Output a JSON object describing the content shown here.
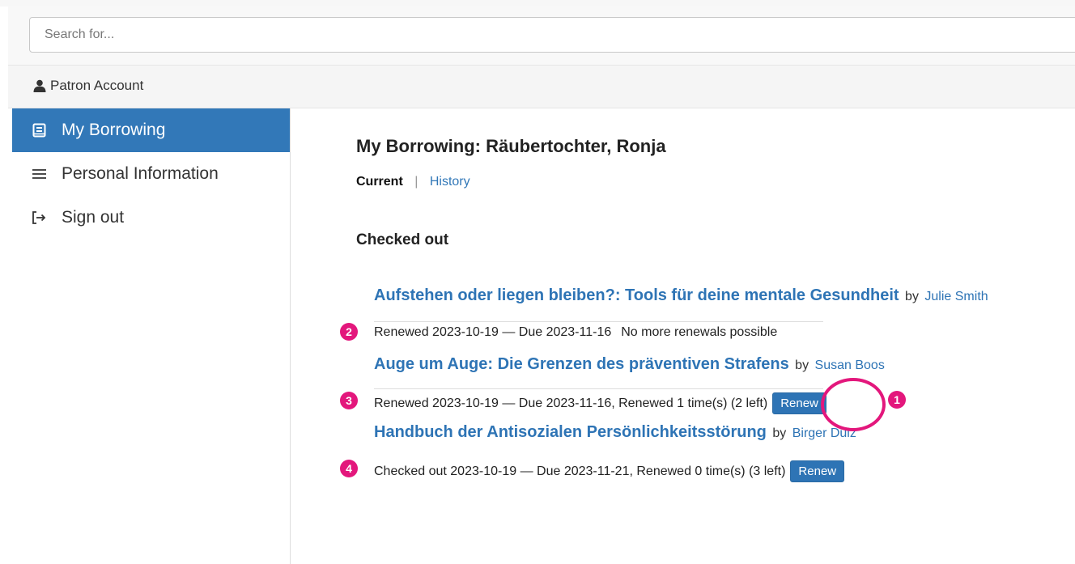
{
  "search": {
    "placeholder": "Search for..."
  },
  "account": {
    "label": "Patron Account",
    "icon": "user-icon"
  },
  "sidebar": {
    "items": [
      {
        "label": "My Borrowing",
        "icon": "book-icon",
        "active": true
      },
      {
        "label": "Personal Information",
        "icon": "list-icon",
        "active": false
      },
      {
        "label": "Sign out",
        "icon": "sign-out-icon",
        "active": false
      }
    ]
  },
  "main": {
    "title": "My Borrowing: Räubertochter, Ronja",
    "subnav": {
      "current": "Current",
      "separator": "|",
      "history": "History"
    },
    "section_title": "Checked out",
    "by_label": "by",
    "renew_label": "Renew",
    "loans": [
      {
        "title": "Aufstehen oder liegen bleiben?: Tools für deine mentale Gesundheit",
        "author": "Julie Smith",
        "status": "Renewed 2023-10-19 — Due 2023-11-16",
        "note": "No more renewals possible",
        "renewable": false
      },
      {
        "title": "Auge um Auge: Die Grenzen des präventiven Strafens",
        "author": "Susan Boos",
        "status": "Renewed 2023-10-19 — Due 2023-11-16, Renewed 1 time(s) (2 left)",
        "renewable": true
      },
      {
        "title": "Handbuch der Antisozialen Persönlichkeitsstörung",
        "author": "Birger Dulz",
        "status": "Checked out 2023-10-19 — Due 2023-11-21, Renewed 0 time(s) (3 left)",
        "renewable": true
      }
    ]
  },
  "annotations": {
    "markers": [
      "1",
      "2",
      "3",
      "4"
    ],
    "color": "#e3177c"
  },
  "colors": {
    "accent": "#3278b8",
    "link": "#2e74b5"
  }
}
